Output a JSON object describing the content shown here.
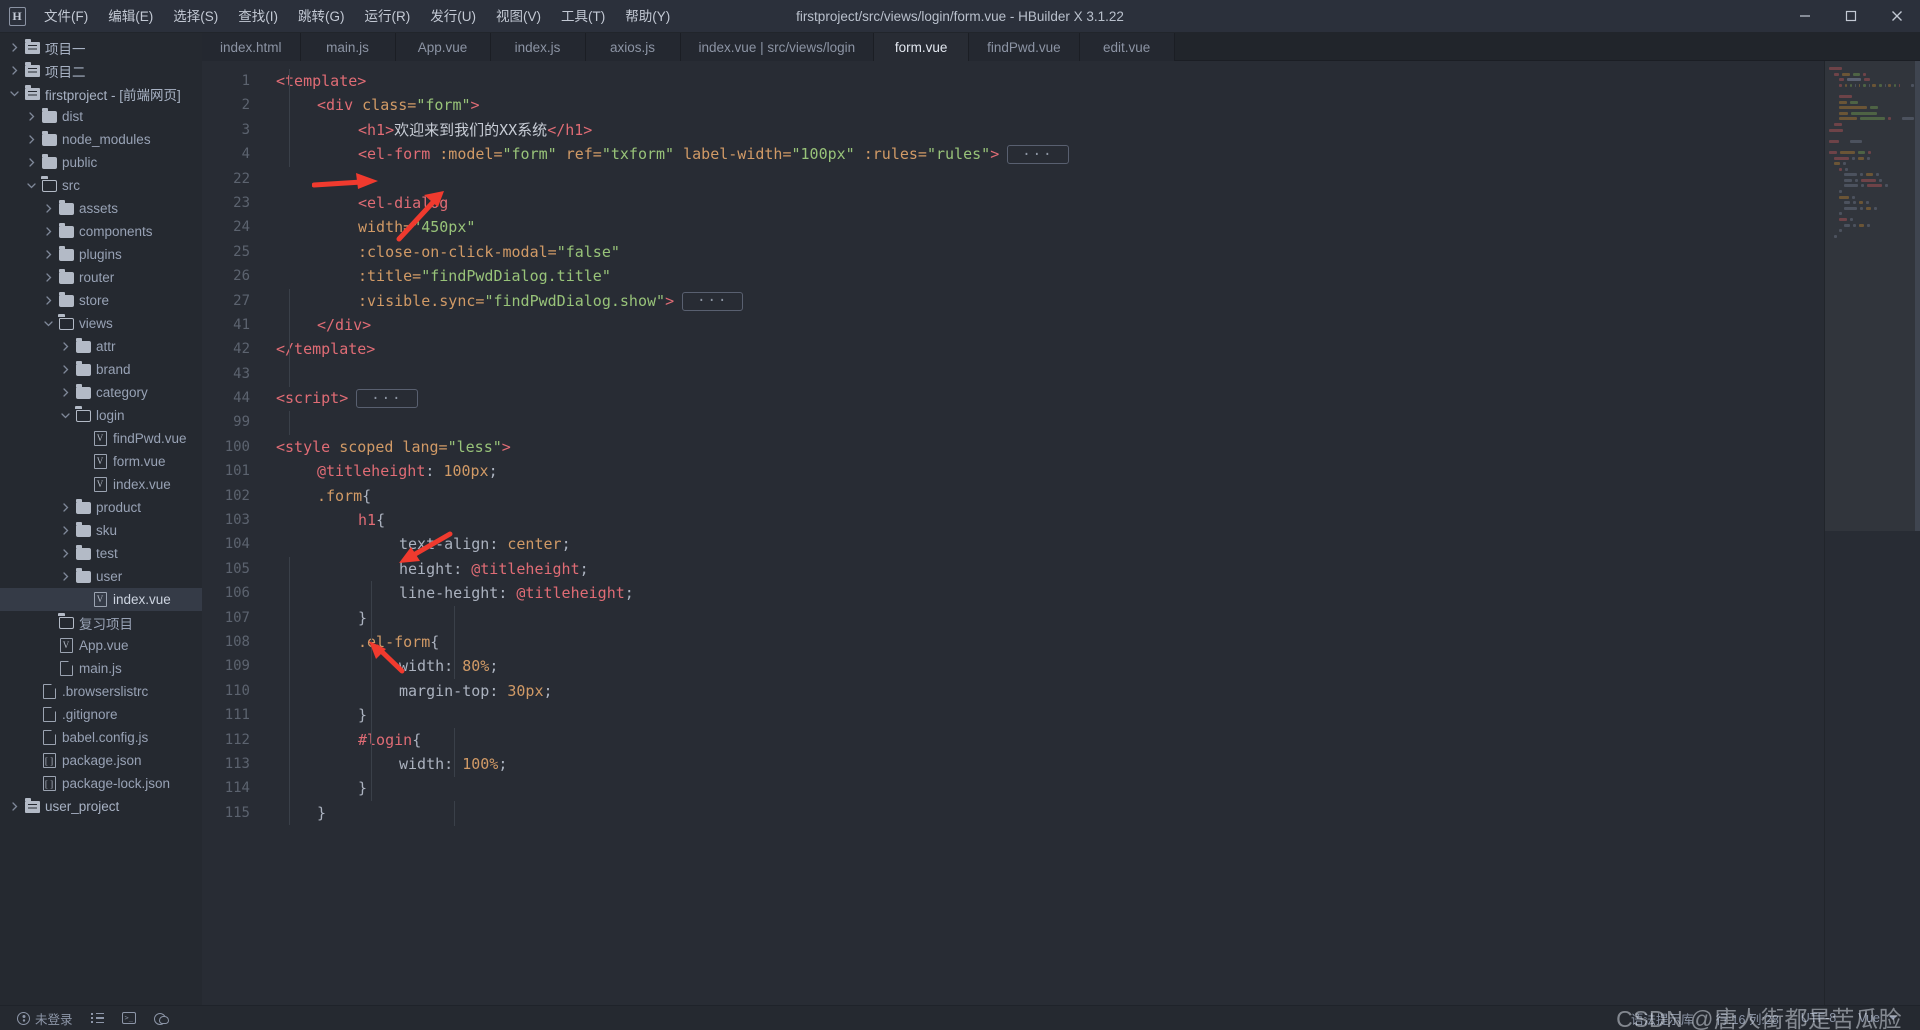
{
  "window": {
    "title": "firstproject/src/views/login/form.vue - HBuilder X 3.1.22",
    "logo": "H",
    "minimize_label": "─",
    "maximize_label": "□",
    "close_label": "✕"
  },
  "menubar": [
    {
      "label": "文件(F)",
      "name": "menu-file"
    },
    {
      "label": "编辑(E)",
      "name": "menu-edit"
    },
    {
      "label": "选择(S)",
      "name": "menu-select"
    },
    {
      "label": "查找(I)",
      "name": "menu-find"
    },
    {
      "label": "跳转(G)",
      "name": "menu-goto"
    },
    {
      "label": "运行(R)",
      "name": "menu-run"
    },
    {
      "label": "发行(U)",
      "name": "menu-publish"
    },
    {
      "label": "视图(V)",
      "name": "menu-view"
    },
    {
      "label": "工具(T)",
      "name": "menu-tools"
    },
    {
      "label": "帮助(Y)",
      "name": "menu-help"
    }
  ],
  "tabs": [
    {
      "label": "index.html",
      "active": false
    },
    {
      "label": "main.js",
      "active": false
    },
    {
      "label": "App.vue",
      "active": false
    },
    {
      "label": "index.js",
      "active": false
    },
    {
      "label": "axios.js",
      "active": false
    },
    {
      "label": "index.vue | src/views/login",
      "active": false
    },
    {
      "label": "form.vue",
      "active": true
    },
    {
      "label": "findPwd.vue",
      "active": false
    },
    {
      "label": "edit.vue",
      "active": false
    }
  ],
  "sidebar": {
    "tree": [
      {
        "label": "项目一",
        "depth": 0,
        "icon": "project-folder",
        "twisty": "collapsed",
        "selected": false
      },
      {
        "label": "项目二",
        "depth": 0,
        "icon": "project-folder",
        "twisty": "collapsed",
        "selected": false
      },
      {
        "label": "firstproject - [前端网页]",
        "depth": 0,
        "icon": "project-folder",
        "twisty": "expanded",
        "selected": false
      },
      {
        "label": "dist",
        "depth": 1,
        "icon": "folder",
        "twisty": "collapsed",
        "selected": false
      },
      {
        "label": "node_modules",
        "depth": 1,
        "icon": "folder",
        "twisty": "collapsed",
        "selected": false
      },
      {
        "label": "public",
        "depth": 1,
        "icon": "folder",
        "twisty": "collapsed",
        "selected": false
      },
      {
        "label": "src",
        "depth": 1,
        "icon": "folder-open",
        "twisty": "expanded",
        "selected": false
      },
      {
        "label": "assets",
        "depth": 2,
        "icon": "folder",
        "twisty": "collapsed",
        "selected": false
      },
      {
        "label": "components",
        "depth": 2,
        "icon": "folder",
        "twisty": "collapsed",
        "selected": false
      },
      {
        "label": "plugins",
        "depth": 2,
        "icon": "folder",
        "twisty": "collapsed",
        "selected": false
      },
      {
        "label": "router",
        "depth": 2,
        "icon": "folder",
        "twisty": "collapsed",
        "selected": false
      },
      {
        "label": "store",
        "depth": 2,
        "icon": "folder",
        "twisty": "collapsed",
        "selected": false
      },
      {
        "label": "views",
        "depth": 2,
        "icon": "folder-open",
        "twisty": "expanded",
        "selected": false
      },
      {
        "label": "attr",
        "depth": 3,
        "icon": "folder",
        "twisty": "collapsed",
        "selected": false
      },
      {
        "label": "brand",
        "depth": 3,
        "icon": "folder",
        "twisty": "collapsed",
        "selected": false
      },
      {
        "label": "category",
        "depth": 3,
        "icon": "folder",
        "twisty": "collapsed",
        "selected": false
      },
      {
        "label": "login",
        "depth": 3,
        "icon": "folder-open",
        "twisty": "expanded",
        "selected": false
      },
      {
        "label": "findPwd.vue",
        "depth": 4,
        "icon": "vue-file",
        "twisty": "none",
        "selected": false
      },
      {
        "label": "form.vue",
        "depth": 4,
        "icon": "vue-file",
        "twisty": "none",
        "selected": false
      },
      {
        "label": "index.vue",
        "depth": 4,
        "icon": "vue-file",
        "twisty": "none",
        "selected": false
      },
      {
        "label": "product",
        "depth": 3,
        "icon": "folder",
        "twisty": "collapsed",
        "selected": false
      },
      {
        "label": "sku",
        "depth": 3,
        "icon": "folder",
        "twisty": "collapsed",
        "selected": false
      },
      {
        "label": "test",
        "depth": 3,
        "icon": "folder",
        "twisty": "collapsed",
        "selected": false
      },
      {
        "label": "user",
        "depth": 3,
        "icon": "folder",
        "twisty": "collapsed",
        "selected": false
      },
      {
        "label": "index.vue",
        "depth": 4,
        "icon": "vue-file",
        "twisty": "none",
        "selected": true
      },
      {
        "label": "复习项目",
        "depth": 2,
        "icon": "folder-open",
        "twisty": "none",
        "selected": false
      },
      {
        "label": "App.vue",
        "depth": 2,
        "icon": "vue-file",
        "twisty": "none",
        "selected": false
      },
      {
        "label": "main.js",
        "depth": 2,
        "icon": "js-file",
        "twisty": "none",
        "selected": false
      },
      {
        "label": ".browserslistrc",
        "depth": 1,
        "icon": "doc-file",
        "twisty": "none",
        "selected": false
      },
      {
        "label": ".gitignore",
        "depth": 1,
        "icon": "doc-file",
        "twisty": "none",
        "selected": false
      },
      {
        "label": "babel.config.js",
        "depth": 1,
        "icon": "js-file",
        "twisty": "none",
        "selected": false
      },
      {
        "label": "package.json",
        "depth": 1,
        "icon": "json-file",
        "twisty": "none",
        "selected": false
      },
      {
        "label": "package-lock.json",
        "depth": 1,
        "icon": "json-file",
        "twisty": "none",
        "selected": false
      },
      {
        "label": "user_project",
        "depth": 0,
        "icon": "project-folder",
        "twisty": "collapsed",
        "selected": false
      }
    ]
  },
  "editor": {
    "filename": "form.vue",
    "lines": [
      {
        "num": "1",
        "fold": "minus",
        "indent": 0,
        "tokens": [
          {
            "t": "tag",
            "v": "<template>"
          }
        ]
      },
      {
        "num": "2",
        "fold": "minus",
        "indent": 1,
        "tokens": [
          {
            "t": "tag",
            "v": "<div "
          },
          {
            "t": "attr",
            "v": "class="
          },
          {
            "t": "str",
            "v": "\"form\""
          },
          {
            "t": "tag",
            "v": ">"
          }
        ]
      },
      {
        "num": "3",
        "fold": "",
        "indent": 2,
        "tokens": [
          {
            "t": "tag",
            "v": "<h1>"
          },
          {
            "t": "txt",
            "v": "欢迎来到我们的XX系统"
          },
          {
            "t": "tag",
            "v": "</h1>"
          }
        ]
      },
      {
        "num": "4",
        "fold": "plus",
        "indent": 2,
        "tokens": [
          {
            "t": "tag",
            "v": "<el-form "
          },
          {
            "t": "attr",
            "v": ":model="
          },
          {
            "t": "str",
            "v": "\"form\""
          },
          {
            "t": "pun",
            "v": " "
          },
          {
            "t": "attr",
            "v": "ref="
          },
          {
            "t": "str",
            "v": "\"txform\""
          },
          {
            "t": "pun",
            "v": " "
          },
          {
            "t": "attr",
            "v": "label-width="
          },
          {
            "t": "str",
            "v": "\"100px\""
          },
          {
            "t": "pun",
            "v": " "
          },
          {
            "t": "attr",
            "v": ":rules="
          },
          {
            "t": "str",
            "v": "\"rules\""
          },
          {
            "t": "tag",
            "v": ">"
          }
        ],
        "collapsed": "···"
      },
      {
        "num": "22",
        "fold": "",
        "indent": 0,
        "tokens": []
      },
      {
        "num": "23",
        "fold": "",
        "indent": 2,
        "tokens": [
          {
            "t": "tag",
            "v": "<el-dialog"
          }
        ]
      },
      {
        "num": "24",
        "fold": "",
        "indent": 2,
        "tokens": [
          {
            "t": "attr",
            "v": "width="
          },
          {
            "t": "str",
            "v": "\"450px\""
          }
        ]
      },
      {
        "num": "25",
        "fold": "",
        "indent": 2,
        "tokens": [
          {
            "t": "attr",
            "v": ":close-on-click-modal="
          },
          {
            "t": "str",
            "v": "\"false\""
          }
        ]
      },
      {
        "num": "26",
        "fold": "",
        "indent": 2,
        "tokens": [
          {
            "t": "attr",
            "v": ":title="
          },
          {
            "t": "str",
            "v": "\"findPwdDialog.title\""
          }
        ]
      },
      {
        "num": "27",
        "fold": "plus",
        "indent": 2,
        "tokens": [
          {
            "t": "attr",
            "v": ":visible.sync="
          },
          {
            "t": "str",
            "v": "\"findPwdDialog.show\""
          },
          {
            "t": "tag",
            "v": ">"
          }
        ],
        "collapsed": "···"
      },
      {
        "num": "41",
        "fold": "",
        "indent": 1,
        "tokens": [
          {
            "t": "tag",
            "v": "</div>"
          }
        ]
      },
      {
        "num": "42",
        "fold": "",
        "indent": 0,
        "tokens": [
          {
            "t": "tag",
            "v": "</template>"
          }
        ]
      },
      {
        "num": "43",
        "fold": "",
        "indent": 0,
        "tokens": []
      },
      {
        "num": "44",
        "fold": "plus",
        "indent": 0,
        "tokens": [
          {
            "t": "tag",
            "v": "<script>"
          }
        ],
        "collapsed": "···"
      },
      {
        "num": "99",
        "fold": "",
        "indent": 0,
        "tokens": []
      },
      {
        "num": "100",
        "fold": "minus",
        "indent": 0,
        "tokens": [
          {
            "t": "tag",
            "v": "<style "
          },
          {
            "t": "attr",
            "v": "scoped lang="
          },
          {
            "t": "str",
            "v": "\"less\""
          },
          {
            "t": "tag",
            "v": ">"
          }
        ]
      },
      {
        "num": "101",
        "fold": "",
        "indent": 1,
        "tokens": [
          {
            "t": "var",
            "v": "@titleheight"
          },
          {
            "t": "pun",
            "v": ": "
          },
          {
            "t": "num",
            "v": "100px"
          },
          {
            "t": "pun",
            "v": ";"
          }
        ]
      },
      {
        "num": "102",
        "fold": "minus",
        "indent": 1,
        "tokens": [
          {
            "t": "sel",
            "v": ".form"
          },
          {
            "t": "pun",
            "v": "{"
          }
        ]
      },
      {
        "num": "103",
        "fold": "minus",
        "indent": 2,
        "tokens": [
          {
            "t": "var",
            "v": "h1"
          },
          {
            "t": "pun",
            "v": "{"
          }
        ]
      },
      {
        "num": "104",
        "fold": "",
        "indent": 3,
        "tokens": [
          {
            "t": "prop",
            "v": "text-align"
          },
          {
            "t": "pun",
            "v": ": "
          },
          {
            "t": "num",
            "v": "center"
          },
          {
            "t": "pun",
            "v": ";"
          }
        ]
      },
      {
        "num": "105",
        "fold": "",
        "indent": 3,
        "tokens": [
          {
            "t": "prop",
            "v": "height"
          },
          {
            "t": "pun",
            "v": ": "
          },
          {
            "t": "var",
            "v": "@titleheight"
          },
          {
            "t": "pun",
            "v": ";"
          }
        ]
      },
      {
        "num": "106",
        "fold": "",
        "indent": 3,
        "tokens": [
          {
            "t": "prop",
            "v": "line-height"
          },
          {
            "t": "pun",
            "v": ": "
          },
          {
            "t": "var",
            "v": "@titleheight"
          },
          {
            "t": "pun",
            "v": ";"
          }
        ]
      },
      {
        "num": "107",
        "fold": "",
        "indent": 2,
        "tokens": [
          {
            "t": "pun",
            "v": "}"
          }
        ]
      },
      {
        "num": "108",
        "fold": "minus",
        "indent": 2,
        "tokens": [
          {
            "t": "sel",
            "v": ".el-form"
          },
          {
            "t": "pun",
            "v": "{"
          }
        ]
      },
      {
        "num": "109",
        "fold": "",
        "indent": 3,
        "tokens": [
          {
            "t": "prop",
            "v": "width"
          },
          {
            "t": "pun",
            "v": ": "
          },
          {
            "t": "num",
            "v": "80%"
          },
          {
            "t": "pun",
            "v": ";"
          }
        ]
      },
      {
        "num": "110",
        "fold": "",
        "indent": 3,
        "tokens": [
          {
            "t": "prop",
            "v": "margin-top"
          },
          {
            "t": "pun",
            "v": ": "
          },
          {
            "t": "num",
            "v": "30px"
          },
          {
            "t": "pun",
            "v": ";"
          }
        ]
      },
      {
        "num": "111",
        "fold": "",
        "indent": 2,
        "tokens": [
          {
            "t": "pun",
            "v": "}"
          }
        ]
      },
      {
        "num": "112",
        "fold": "minus",
        "indent": 2,
        "tokens": [
          {
            "t": "id",
            "v": "#login"
          },
          {
            "t": "pun",
            "v": "{"
          }
        ]
      },
      {
        "num": "113",
        "fold": "",
        "indent": 3,
        "tokens": [
          {
            "t": "prop",
            "v": "width"
          },
          {
            "t": "pun",
            "v": ": "
          },
          {
            "t": "num",
            "v": "100%"
          },
          {
            "t": "pun",
            "v": ";"
          }
        ]
      },
      {
        "num": "114",
        "fold": "",
        "indent": 2,
        "tokens": [
          {
            "t": "pun",
            "v": "}"
          }
        ]
      },
      {
        "num": "115",
        "fold": "",
        "indent": 1,
        "tokens": [
          {
            "t": "pun",
            "v": "}"
          }
        ]
      }
    ]
  },
  "statusbar": {
    "login": "未登录",
    "syntax_library": "语法提示库",
    "cursor": "行:16 列:28",
    "encoding": "UTF-8",
    "language": "Vue",
    "watermark": "CSDN @唐人街都是苦瓜脸"
  },
  "colors": {
    "background": "#282c34",
    "sidebar_bg": "#252930",
    "titlebar_bg": "#2b303b",
    "tag": "#e06c75",
    "attribute": "#d19a66",
    "string": "#98c379",
    "text": "#abb2bf",
    "annotation_arrow": "#f03a2e"
  }
}
